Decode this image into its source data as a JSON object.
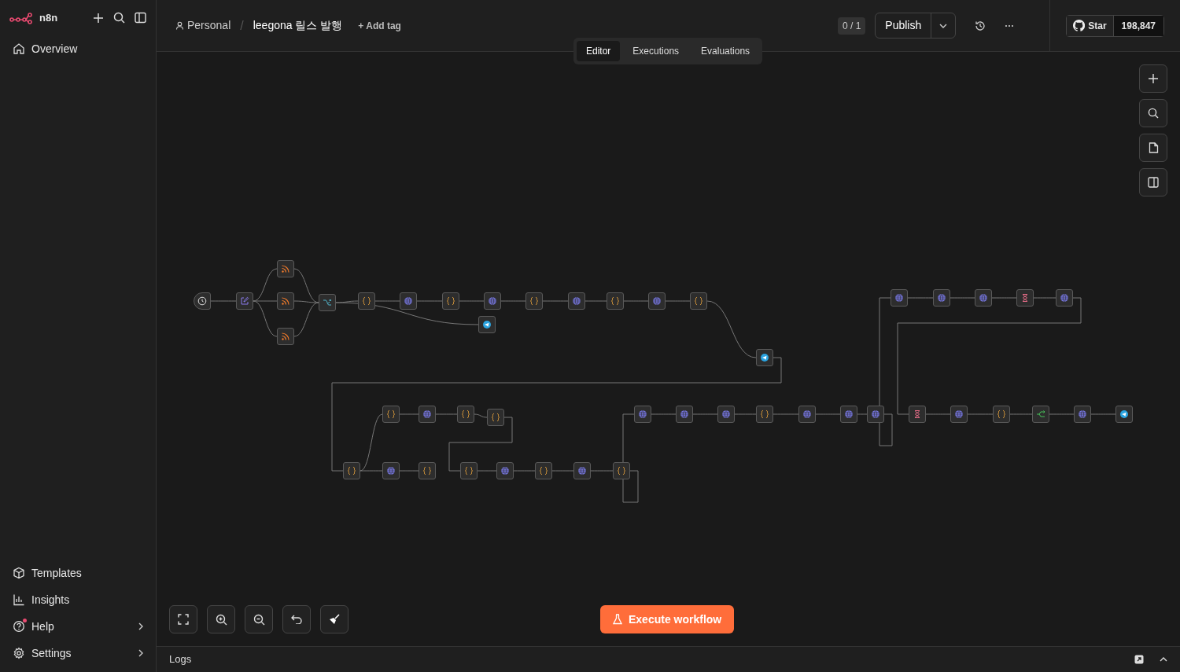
{
  "sidebar": {
    "brand": "n8n",
    "items": [
      {
        "label": "Overview"
      }
    ],
    "bottom_items": [
      {
        "label": "Templates",
        "chevron": false,
        "notification": false
      },
      {
        "label": "Insights",
        "chevron": false,
        "notification": false
      },
      {
        "label": "Help",
        "chevron": true,
        "notification": true
      },
      {
        "label": "Settings",
        "chevron": true,
        "notification": false
      }
    ]
  },
  "header": {
    "project": "Personal",
    "separator": "/",
    "workflow_name": "leegona 릴스 발행",
    "add_tag": "+ Add tag",
    "counter": "0 / 1",
    "publish": "Publish",
    "github": {
      "star": "Star",
      "count": "198,847"
    }
  },
  "tabs": [
    {
      "label": "Editor",
      "selected": true
    },
    {
      "label": "Executions",
      "selected": false
    },
    {
      "label": "Evaluations",
      "selected": false
    }
  ],
  "canvas": {
    "nodes": [
      {
        "kind": "trigger"
      },
      {
        "kind": "edit"
      },
      {
        "kind": "rss"
      },
      {
        "kind": "rss"
      },
      {
        "kind": "rss"
      },
      {
        "kind": "merge"
      },
      {
        "kind": "code"
      },
      {
        "kind": "http"
      },
      {
        "kind": "code"
      },
      {
        "kind": "http"
      },
      {
        "kind": "telegram"
      },
      {
        "kind": "code"
      },
      {
        "kind": "http"
      },
      {
        "kind": "code"
      },
      {
        "kind": "http"
      },
      {
        "kind": "code"
      },
      {
        "kind": "telegram"
      },
      {
        "kind": "http"
      },
      {
        "kind": "http"
      },
      {
        "kind": "http"
      },
      {
        "kind": "wait"
      },
      {
        "kind": "http"
      },
      {
        "kind": "code"
      },
      {
        "kind": "http"
      },
      {
        "kind": "code"
      },
      {
        "kind": "code"
      },
      {
        "kind": "code"
      },
      {
        "kind": "http"
      },
      {
        "kind": "code"
      },
      {
        "kind": "code"
      },
      {
        "kind": "http"
      },
      {
        "kind": "code"
      },
      {
        "kind": "http"
      },
      {
        "kind": "code"
      },
      {
        "kind": "http"
      },
      {
        "kind": "http"
      },
      {
        "kind": "http"
      },
      {
        "kind": "code"
      },
      {
        "kind": "http"
      },
      {
        "kind": "http"
      },
      {
        "kind": "http"
      },
      {
        "kind": "wait"
      },
      {
        "kind": "http"
      },
      {
        "kind": "code"
      },
      {
        "kind": "switch"
      },
      {
        "kind": "http"
      },
      {
        "kind": "telegram"
      }
    ]
  },
  "execute_button": "Execute workflow",
  "logs": {
    "label": "Logs"
  }
}
